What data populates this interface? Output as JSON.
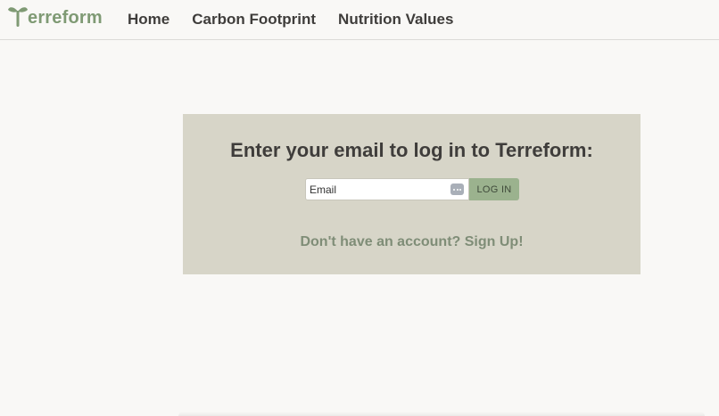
{
  "brand": {
    "name": "erreform",
    "logo_icon": "sprout-T-icon",
    "color": "#7f9a74"
  },
  "nav": {
    "items": [
      {
        "label": "Home"
      },
      {
        "label": "Carbon Footprint"
      },
      {
        "label": "Nutrition Values"
      }
    ]
  },
  "login": {
    "heading": "Enter your email to log in to Terreform:",
    "email_placeholder": "Email",
    "email_value": "",
    "autofill_icon": "password-autofill-icon",
    "button_label": "LOG IN",
    "signup_prompt": "Don't have an account?",
    "signup_link": "Sign Up!"
  },
  "colors": {
    "background": "#f9f8f6",
    "panel": "#d7d5c8",
    "button": "#9bb28e",
    "heading_text": "#3f3d3b",
    "signup_text": "#7f8d77"
  }
}
